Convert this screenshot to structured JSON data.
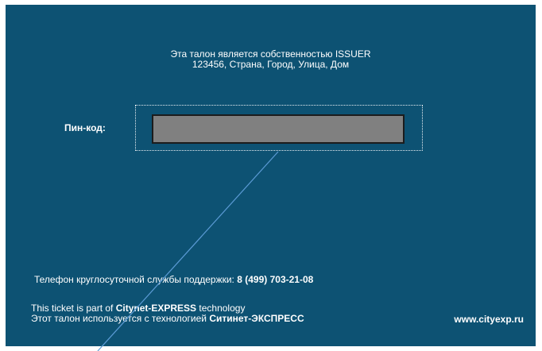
{
  "ticket": {
    "owner_line1": "Эта талон является собственностью ISSUER",
    "owner_line2": "123456, Страна, Город, Улица, Дом",
    "pin_label": "Пин-код:",
    "support_prefix": "Телефон круглосуточной службы поддержки: ",
    "support_phone": "8 (499) 703-21-08",
    "tech_en_prefix": "This ticket is part of ",
    "tech_en_brand": "Citynet-EXPRESS",
    "tech_en_suffix": " technology",
    "tech_ru_prefix": "Этот талон используется с технологией ",
    "tech_ru_brand": "Ситинет-ЭКСПРЕСС",
    "website": "www.cityexp.ru"
  },
  "colors": {
    "card_background": "#0d5273",
    "pin_field": "#808080",
    "leader_line": "#5b9bd5"
  }
}
